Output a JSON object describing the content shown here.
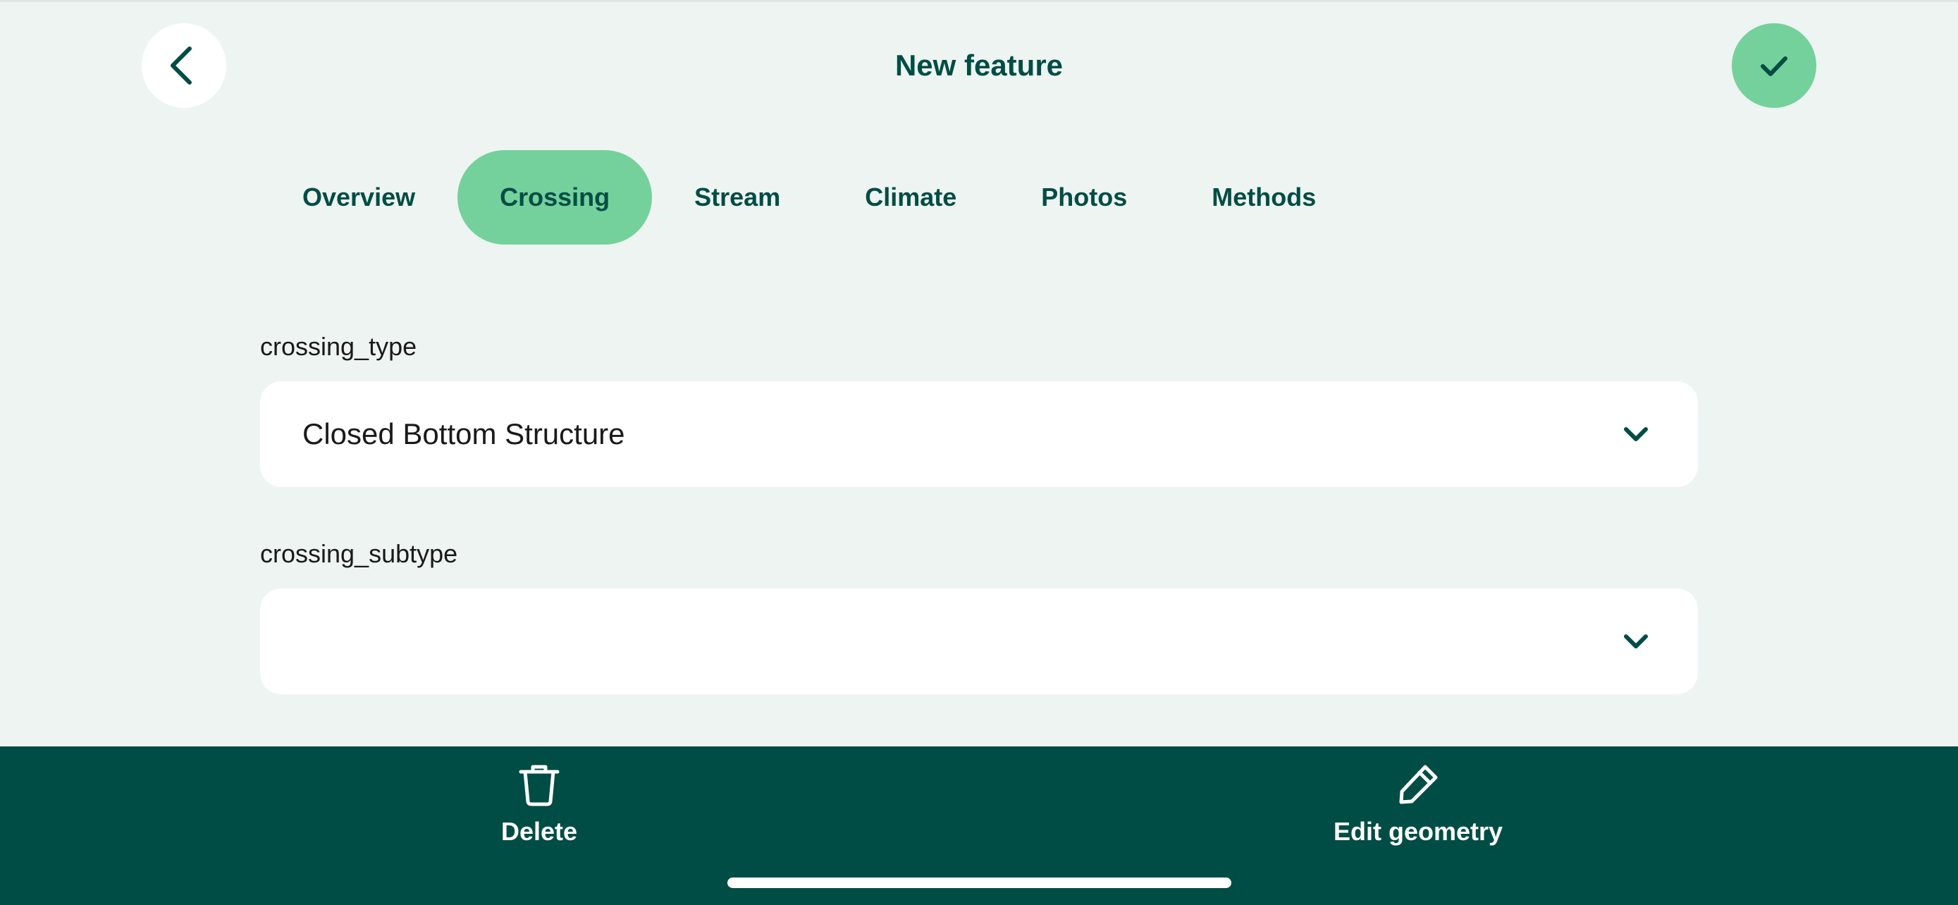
{
  "header": {
    "title": "New feature",
    "back_icon": "chevron-left-icon",
    "confirm_icon": "check-icon"
  },
  "tabs": [
    {
      "label": "Overview",
      "active": false
    },
    {
      "label": "Crossing",
      "active": true
    },
    {
      "label": "Stream",
      "active": false
    },
    {
      "label": "Climate",
      "active": false
    },
    {
      "label": "Photos",
      "active": false
    },
    {
      "label": "Methods",
      "active": false
    }
  ],
  "form": {
    "crossing_type": {
      "label": "crossing_type",
      "value": "Closed Bottom Structure"
    },
    "crossing_subtype": {
      "label": "crossing_subtype",
      "value": ""
    }
  },
  "bottom_bar": {
    "delete": {
      "label": "Delete",
      "icon": "trash-icon"
    },
    "edit_geometry": {
      "label": "Edit geometry",
      "icon": "pencil-icon"
    }
  },
  "colors": {
    "background": "#eef4f1",
    "primary_dark": "#004d45",
    "accent": "#74d19c",
    "surface": "#ffffff"
  }
}
